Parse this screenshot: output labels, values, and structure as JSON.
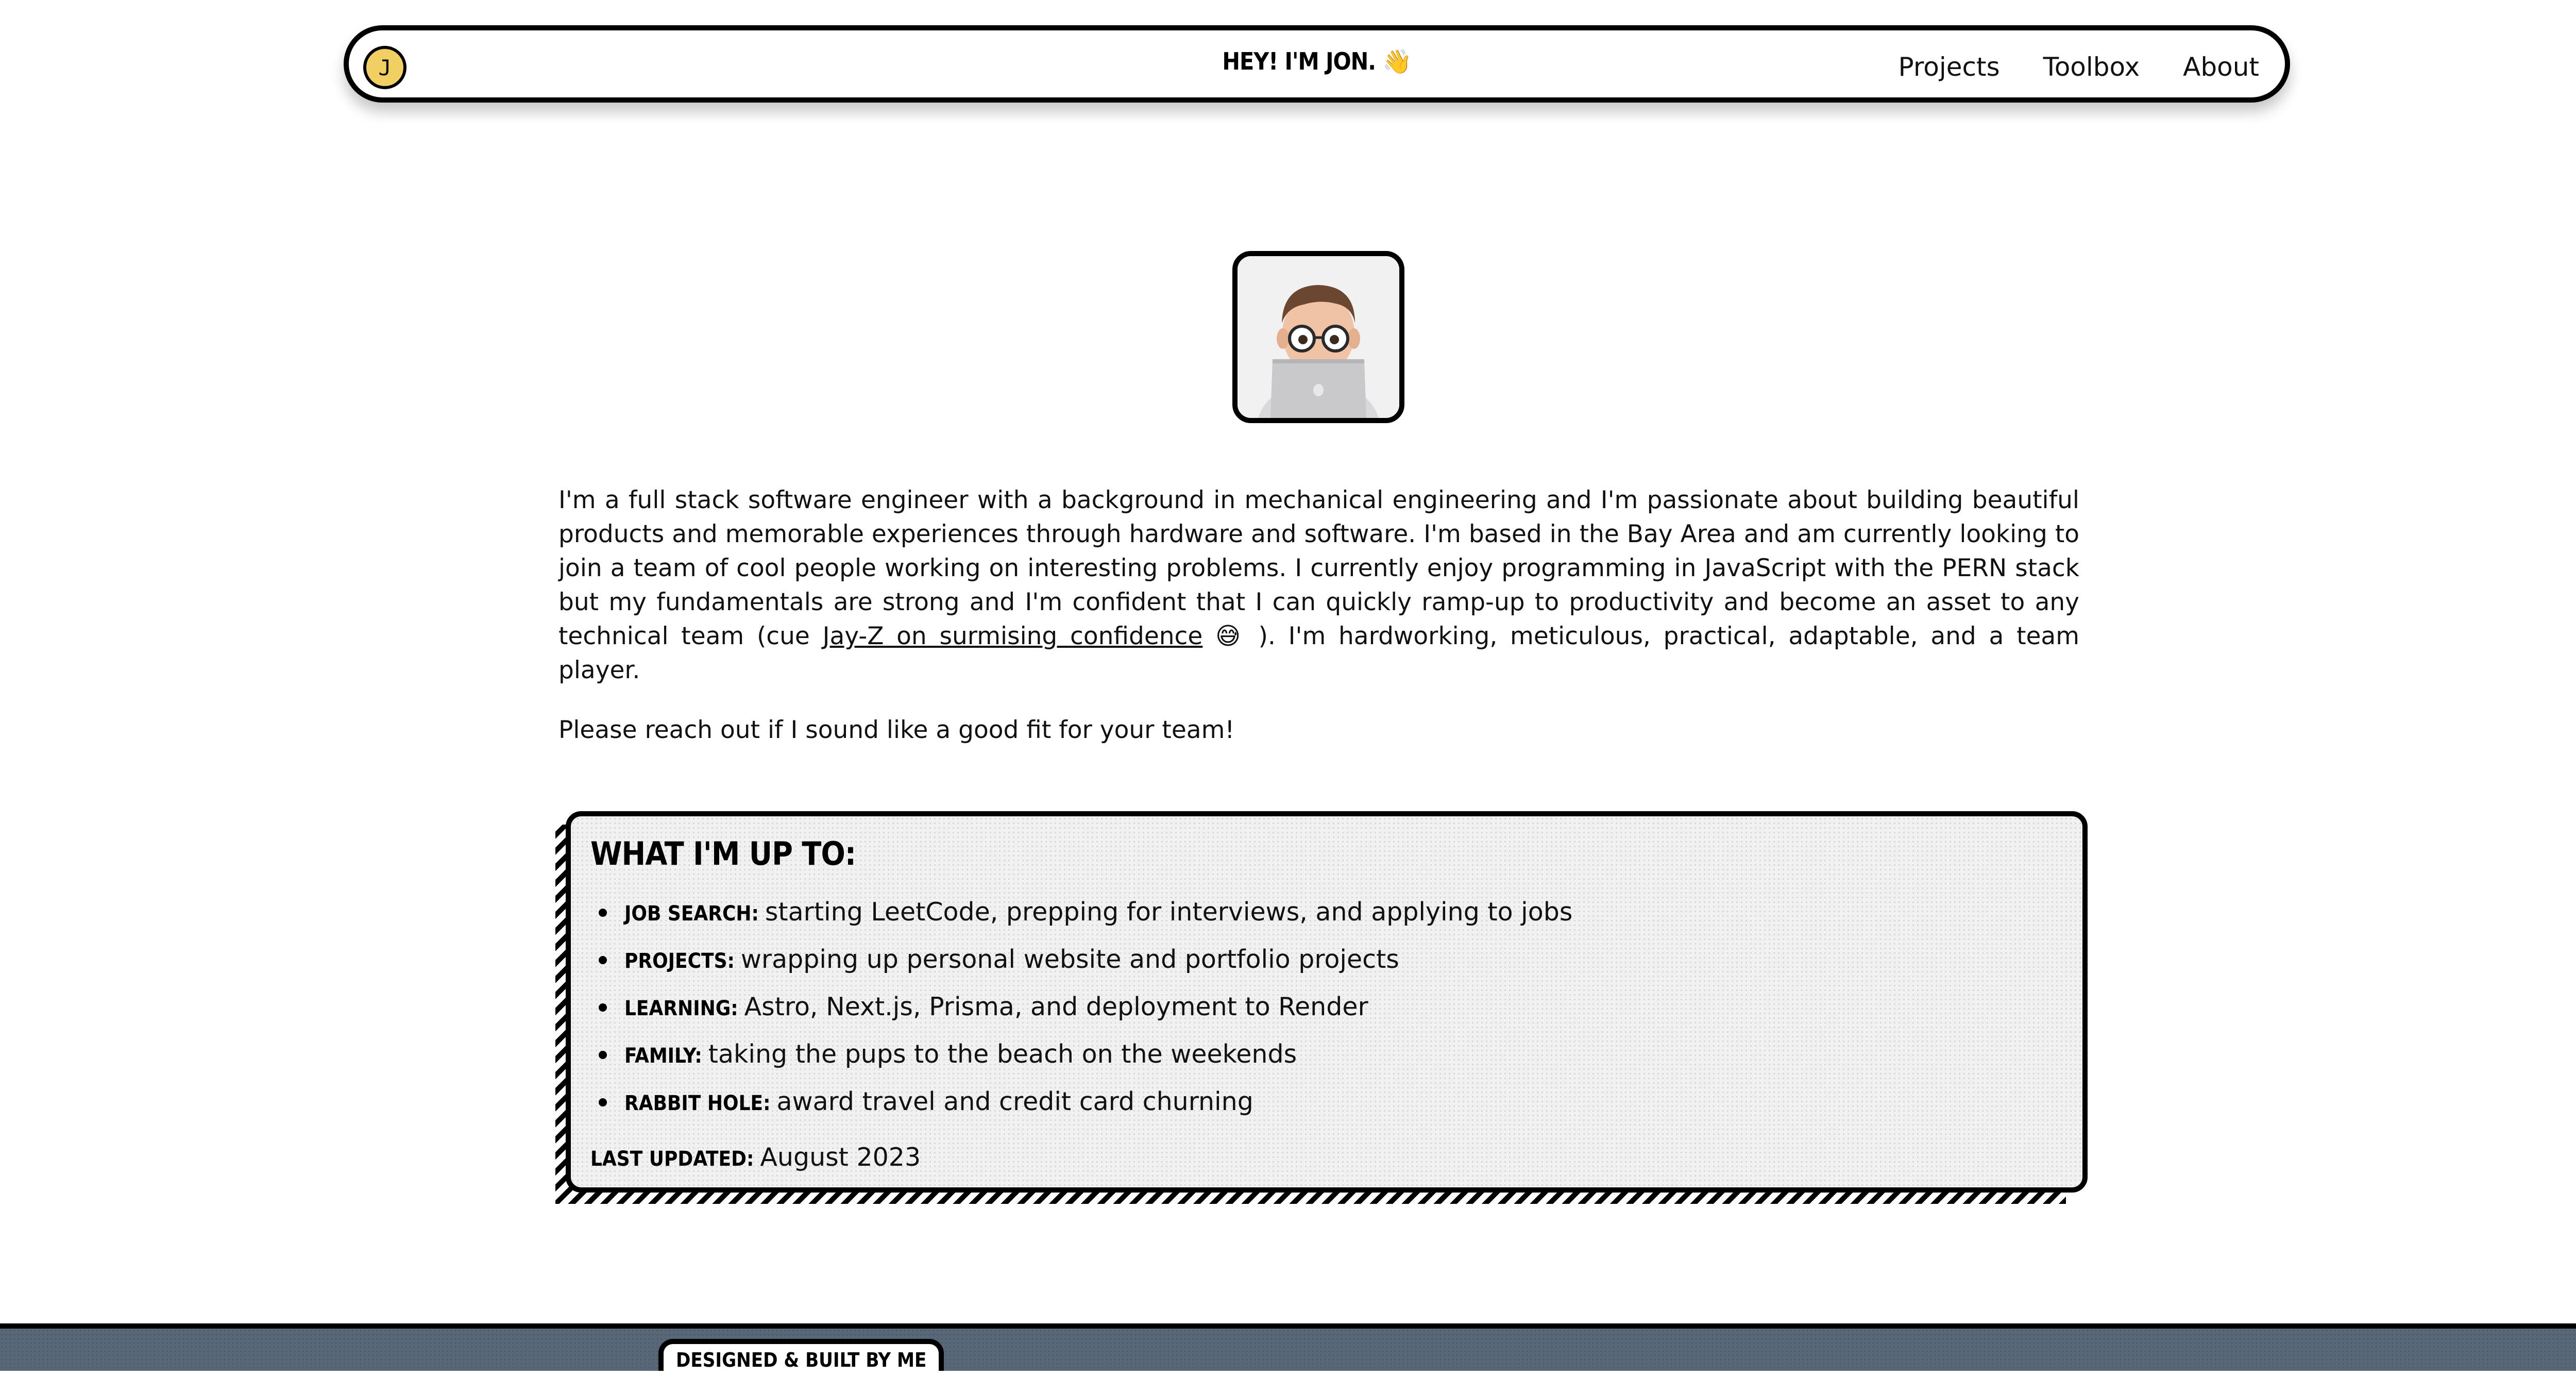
{
  "nav": {
    "logo_letter": "J",
    "title": "HEY! I'M JON. 👋",
    "links": [
      "Projects",
      "Toolbox",
      "About"
    ]
  },
  "avatar": {
    "icon": "memoji-avatar-with-laptop"
  },
  "bio": {
    "p1_before_link": "I'm a full stack software engineer with a background in mechanical engineering and I'm passionate about building beautiful products and memorable experiences through hardware and software. I'm based in the Bay Area and am currently looking to join a team of cool people working on interesting problems. I currently enjoy programming in JavaScript with the PERN stack but my fundamentals are strong and I'm confident that I can quickly ramp-up to productivity and become an asset to any technical team (cue ",
    "link_text": "Jay-Z on surmising confidence",
    "emoji": "😅",
    "p1_after_link": " ). I'm hardworking, meticulous, practical, adaptable, and a team player.",
    "p2": "Please reach out if I sound like a good fit for your team!"
  },
  "status": {
    "heading": "WHAT I'M UP TO:",
    "items": [
      {
        "label": "JOB SEARCH:",
        "text": "starting LeetCode, prepping for interviews, and applying to jobs"
      },
      {
        "label": "PROJECTS:",
        "text": "wrapping up personal website and portfolio projects"
      },
      {
        "label": "LEARNING:",
        "text": "Astro, Next.js, Prisma, and deployment to Render"
      },
      {
        "label": "FAMILY:",
        "text": "taking the pups to the beach on the weekends"
      },
      {
        "label": "RABBIT HOLE:",
        "text": "award travel and credit card churning"
      }
    ],
    "updated_label": "LAST UPDATED:",
    "updated_value": "August 2023"
  },
  "footer": {
    "badge": "DESIGNED & BUILT BY ME"
  },
  "colors": {
    "accent_yellow": "#f2cf62",
    "footer_slate": "#586878",
    "card_bg": "#f1f1f1"
  }
}
